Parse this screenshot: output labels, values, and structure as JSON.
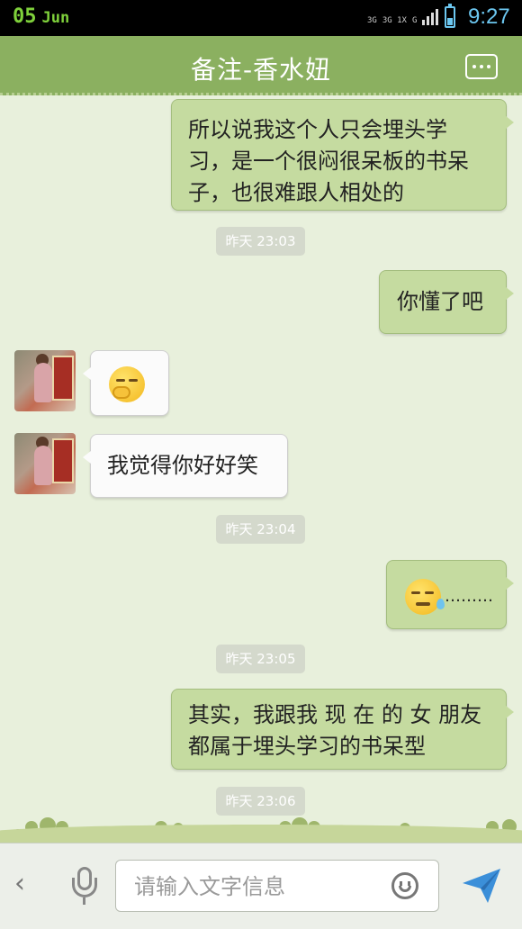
{
  "status_bar": {
    "day": "05",
    "month": "Jun",
    "network_1": "3G",
    "network_2": "3G 1X",
    "network_3": "G",
    "time": "9:27"
  },
  "header": {
    "title": "备注-香水妞"
  },
  "messages": [
    {
      "side": "out",
      "text": "所以说我这个人只会埋头学习，是一个很闷很呆板的书呆子，也很难跟人相处的"
    },
    {
      "side": "out",
      "text": "你懂了吧"
    },
    {
      "side": "in",
      "text": "",
      "emoji": "covering-mouth-emoji"
    },
    {
      "side": "in",
      "text": "我觉得你好好笑"
    },
    {
      "side": "out",
      "text": "………",
      "emoji": "sweat-emoji"
    },
    {
      "side": "out",
      "text": "其实，我跟我 现 在 的 女 朋友 都属于埋头学习的书呆型"
    }
  ],
  "timestamps": [
    "昨天 23:03",
    "昨天 23:04",
    "昨天 23:05",
    "昨天 23:06"
  ],
  "input_bar": {
    "placeholder": "请输入文字信息",
    "value": ""
  },
  "colors": {
    "header_bg": "#8bb060",
    "chat_bg": "#e8f0dc",
    "out_bubble": "#c5dba0",
    "in_bubble": "#fbfbfb",
    "clock": "#6cc7f0",
    "date": "#7fd13b",
    "send_icon": "#3b8fd9"
  }
}
